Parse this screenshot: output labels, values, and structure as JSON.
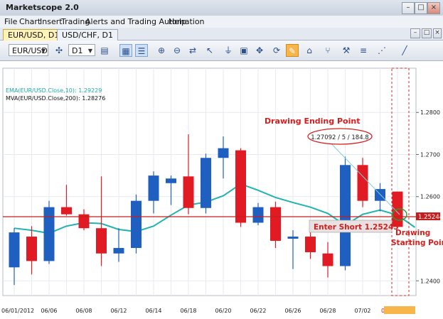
{
  "window": {
    "title": "Marketscope 2.0",
    "controls": {
      "minimize": "–",
      "maximize": "□",
      "close": "×"
    }
  },
  "menu": [
    "File",
    "Chart",
    "Insert",
    "Trading",
    "Alerts and Trading Automation",
    "Help"
  ],
  "tabs": [
    {
      "label": "EUR/USD, D1",
      "active": true
    },
    {
      "label": "USD/CHF, D1",
      "active": false
    }
  ],
  "toolbar": {
    "instrument": "EUR/USD",
    "timeframe": "D1",
    "icons": [
      "cross-icon",
      "bar-chart-icon",
      "grid-icon",
      "list-icon",
      "zoom-icon",
      "zoom-out-icon",
      "nav-icon",
      "cursor-icon",
      "line-tool-icon",
      "fib-icon",
      "pan-icon",
      "hline-icon",
      "note-icon",
      "refresh-icon",
      "bell-icon",
      "alert-icon",
      "pencil-icon",
      "fork-icon",
      "menu-icon",
      "fan-icon",
      "trendline-icon"
    ]
  },
  "indicators": {
    "ema": "EMA(EUR/USD.Close,10): 1.29229",
    "mva": "MVA(EUR/USD.Close,200): 1.28276"
  },
  "annotations": {
    "ending_label": "Drawing Ending Point",
    "measure": "1.27092 / 5 / 184.8",
    "enter_short": "Enter Short 1.25245",
    "starting_line1": "Drawing",
    "starting_line2": "Starting Point",
    "price_tag": "1.25244"
  },
  "colors": {
    "bull": "#1e5fbf",
    "bear": "#e01b24",
    "ema": "#21b3b0",
    "hline": "#c41d1d",
    "label_red": "#d41e1e"
  },
  "chart_data": {
    "type": "candlestick",
    "y_ticks": [
      "1.2800",
      "1.2700",
      "1.2600",
      "1.2400"
    ],
    "x_ticks": [
      "06/01/2012",
      "06/06",
      "06/08",
      "06/12",
      "06/14",
      "06/18",
      "06/20",
      "06/22",
      "06/26",
      "06/28",
      "07/02",
      "07/04/2012"
    ],
    "ylim": [
      1.2365,
      1.2905
    ],
    "candles": [
      {
        "o": 1.2432,
        "h": 1.2525,
        "l": 1.239,
        "c": 1.2515
      },
      {
        "o": 1.2505,
        "h": 1.253,
        "l": 1.2415,
        "c": 1.2447
      },
      {
        "o": 1.2447,
        "h": 1.259,
        "l": 1.244,
        "c": 1.2575
      },
      {
        "o": 1.2575,
        "h": 1.2628,
        "l": 1.2555,
        "c": 1.2558
      },
      {
        "o": 1.2558,
        "h": 1.257,
        "l": 1.252,
        "c": 1.2525
      },
      {
        "o": 1.2525,
        "h": 1.2648,
        "l": 1.2435,
        "c": 1.2465
      },
      {
        "o": 1.2465,
        "h": 1.2525,
        "l": 1.2445,
        "c": 1.2478
      },
      {
        "o": 1.2478,
        "h": 1.2605,
        "l": 1.2465,
        "c": 1.259
      },
      {
        "o": 1.259,
        "h": 1.266,
        "l": 1.256,
        "c": 1.265
      },
      {
        "o": 1.2632,
        "h": 1.265,
        "l": 1.258,
        "c": 1.2643
      },
      {
        "o": 1.2648,
        "h": 1.2748,
        "l": 1.2558,
        "c": 1.2573
      },
      {
        "o": 1.2573,
        "h": 1.2702,
        "l": 1.256,
        "c": 1.2692
      },
      {
        "o": 1.2692,
        "h": 1.2743,
        "l": 1.2643,
        "c": 1.2715
      },
      {
        "o": 1.271,
        "h": 1.2715,
        "l": 1.2528,
        "c": 1.2538
      },
      {
        "o": 1.2538,
        "h": 1.2585,
        "l": 1.2532,
        "c": 1.2575
      },
      {
        "o": 1.2575,
        "h": 1.2588,
        "l": 1.2478,
        "c": 1.2495
      },
      {
        "o": 1.25,
        "h": 1.252,
        "l": 1.2428,
        "c": 1.2505
      },
      {
        "o": 1.2505,
        "h": 1.2525,
        "l": 1.2452,
        "c": 1.2468
      },
      {
        "o": 1.2465,
        "h": 1.2492,
        "l": 1.2408,
        "c": 1.2435
      },
      {
        "o": 1.2435,
        "h": 1.2695,
        "l": 1.2425,
        "c": 1.2675
      },
      {
        "o": 1.2675,
        "h": 1.2692,
        "l": 1.2575,
        "c": 1.259
      },
      {
        "o": 1.259,
        "h": 1.2632,
        "l": 1.2565,
        "c": 1.2618
      },
      {
        "o": 1.2612,
        "h": 1.2612,
        "l": 1.2525,
        "c": 1.2528
      }
    ],
    "ema_values": [
      1.2525,
      1.252,
      1.2513,
      1.253,
      1.2538,
      1.2536,
      1.2522,
      1.2517,
      1.253,
      1.2556,
      1.258,
      1.2587,
      1.2602,
      1.263,
      1.2615,
      1.2598,
      1.2586,
      1.2575,
      1.256,
      1.2532,
      1.2558,
      1.2568,
      1.2556,
      1.2527
    ]
  }
}
